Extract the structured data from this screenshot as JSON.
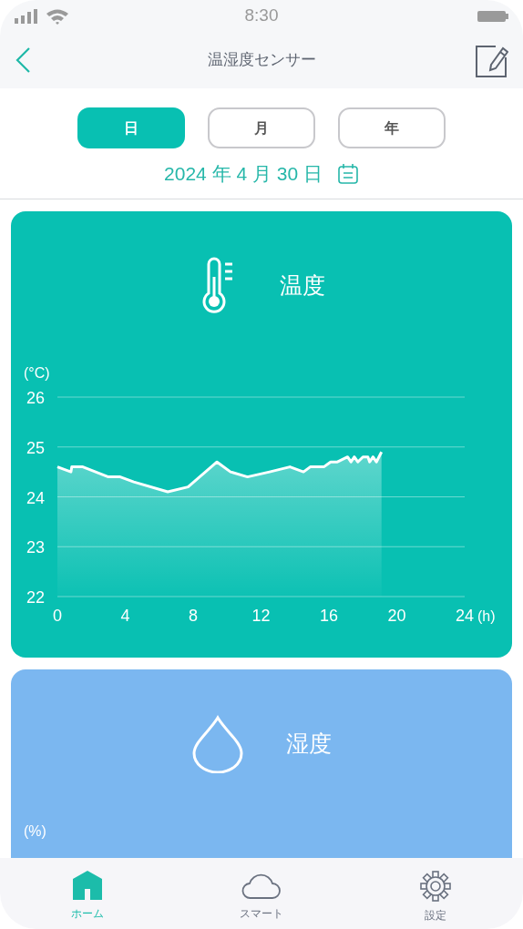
{
  "status_bar": {
    "time": "8:30"
  },
  "header": {
    "title": "温湿度センサー"
  },
  "period_tabs": [
    {
      "label": "日",
      "selected": true
    },
    {
      "label": "月",
      "selected": false
    },
    {
      "label": "年",
      "selected": false
    }
  ],
  "date": "2024 年 4 月 30 日",
  "cards": [
    {
      "kind": "temperature",
      "title": "温度",
      "color": "#08c0b2",
      "unit": "(°C)",
      "chart_data": {
        "type": "area",
        "xlabel": "(h)",
        "xlim": [
          0,
          24
        ],
        "ylim": [
          22,
          26
        ],
        "xticks": [
          0,
          4,
          8,
          12,
          16,
          20,
          24
        ],
        "yticks": [
          22,
          23,
          24,
          25,
          26
        ],
        "x": [
          0,
          0.8,
          0.85,
          1.5,
          3,
          3.7,
          4.5,
          6.5,
          7.7,
          9.4,
          10.2,
          11.2,
          12.5,
          13.7,
          14.5,
          14.9,
          15.7,
          16.1,
          16.5,
          17.1,
          17.3,
          17.5,
          17.7,
          18,
          18.3,
          18.4,
          18.6,
          18.8,
          19.1
        ],
        "grid": true,
        "series": [
          {
            "color": "#ffffff",
            "values": [
              24.6,
              24.5,
              24.6,
              24.6,
              24.4,
              24.4,
              24.3,
              24.1,
              24.2,
              24.7,
              24.5,
              24.4,
              24.5,
              24.6,
              24.5,
              24.6,
              24.6,
              24.7,
              24.7,
              24.8,
              24.7,
              24.8,
              24.7,
              24.8,
              24.8,
              24.7,
              24.8,
              24.7,
              24.9
            ]
          }
        ]
      }
    },
    {
      "kind": "humidity",
      "title": "湿度",
      "color": "#7bb7f0",
      "unit": "(%)"
    }
  ],
  "tab_bar": [
    {
      "kind": "home",
      "label": "ホーム",
      "selected": true
    },
    {
      "kind": "cloud",
      "label": "スマート",
      "selected": false
    },
    {
      "kind": "settings",
      "label": "設定",
      "selected": false
    }
  ]
}
